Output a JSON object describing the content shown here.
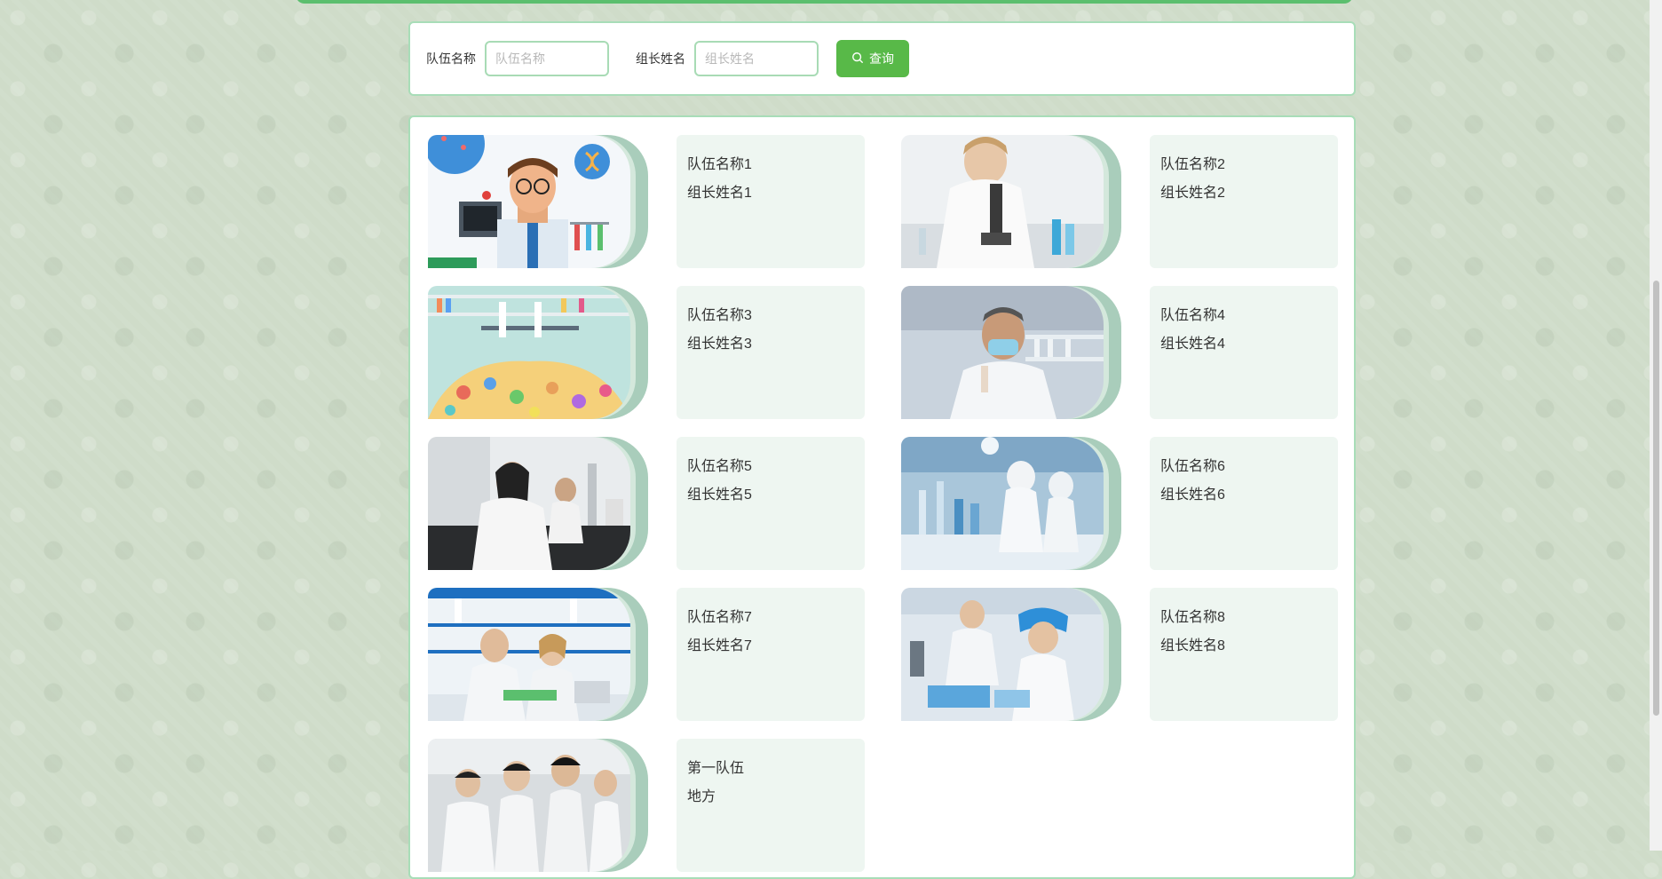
{
  "search": {
    "team_name_label": "队伍名称",
    "team_name_placeholder": "队伍名称",
    "leader_name_label": "组长姓名",
    "leader_name_placeholder": "组长姓名",
    "query_label": "查询",
    "query_icon": "search-icon"
  },
  "cards": [
    {
      "team": "队伍名称1",
      "leader": "组长姓名1",
      "photo": "cartoon-scientist"
    },
    {
      "team": "队伍名称2",
      "leader": "组长姓名2",
      "photo": "scientist-microscope"
    },
    {
      "team": "队伍名称3",
      "leader": "组长姓名3",
      "photo": "lab-illustration"
    },
    {
      "team": "队伍名称4",
      "leader": "组长姓名4",
      "photo": "masked-researcher"
    },
    {
      "team": "队伍名称5",
      "leader": "组长姓名5",
      "photo": "researchers-at-bench"
    },
    {
      "team": "队伍名称6",
      "leader": "组长姓名6",
      "photo": "cleanroom-lab"
    },
    {
      "team": "队伍名称7",
      "leader": "组长姓名7",
      "photo": "lab-team-discussion"
    },
    {
      "team": "队伍名称8",
      "leader": "组长姓名8",
      "photo": "lab-technicians"
    },
    {
      "team": "第一队伍",
      "leader": "地方",
      "photo": "group-of-researchers"
    }
  ],
  "colors": {
    "accent": "#58b948",
    "panel_border": "#a8ddb8",
    "info_bg": "#eef6f1"
  }
}
